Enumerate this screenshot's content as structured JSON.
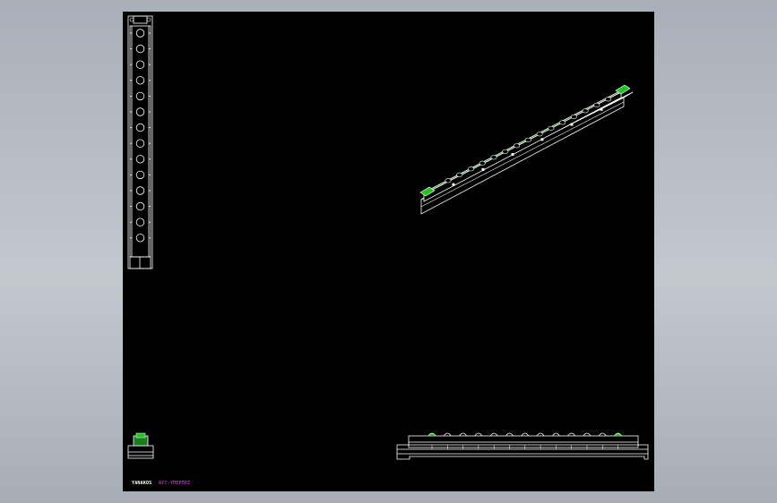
{
  "title_block": {
    "left_text": "YANAKOS",
    "right_text": "ΑΥΞ-ΥΠΕΡΠΟΖ"
  },
  "colors": {
    "background": "#b4b9c0",
    "sheet": "#000000",
    "outline": "#ffffff",
    "fill": "#1e7a1e",
    "highlight": "#22c322",
    "title_text": "#ffffff",
    "subtitle_text": "#ff40ff"
  },
  "views": {
    "front_hole_count": 14,
    "iso_hole_count": 15,
    "side_bump_count": 13
  }
}
